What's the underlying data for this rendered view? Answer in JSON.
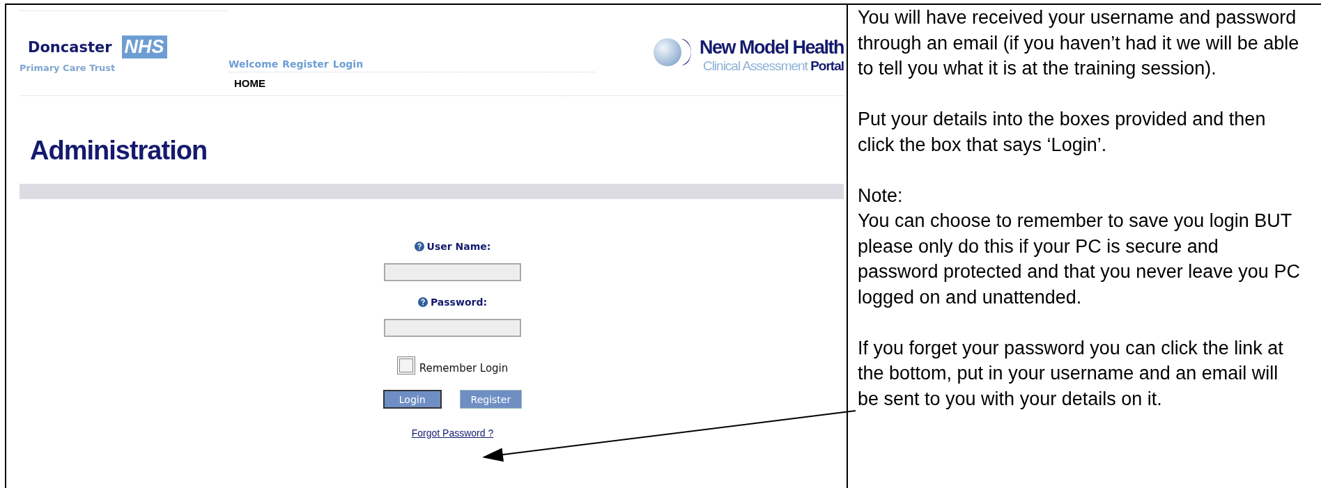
{
  "header": {
    "org_logo": {
      "name": "Doncaster",
      "badge": "NHS",
      "subtitle": "Primary Care Trust"
    },
    "top_links": [
      "Welcome",
      "Register",
      "Login"
    ],
    "nav": [
      "HOME"
    ],
    "brand": {
      "name": "New Model Health",
      "tagline_light": "Clinical Assessment",
      "tagline_bold": "Portal"
    }
  },
  "page_title": "Administration",
  "login_form": {
    "fields": [
      {
        "label": "User Name:"
      },
      {
        "label": "Password:"
      }
    ],
    "remember": {
      "label": "Remember Login",
      "checked": false
    },
    "buttons": [
      {
        "label": "Login",
        "focused": true
      },
      {
        "label": "Register",
        "focused": false
      }
    ],
    "forgot_link": "Forgot Password ?"
  },
  "notes": [
    {
      "lines": [
        "You will have received your username and password through an email (if you haven’t had it we will be able to tell you what it is at the training session)."
      ]
    },
    {
      "lines": [
        "Put your details into the boxes provided and then click the box that says ‘Login’."
      ]
    },
    {
      "lines": [
        "Note:",
        "You can choose to remember to save you login BUT please only do this if your PC is secure and password protected and that you never leave you PC logged on and unattended."
      ]
    },
    {
      "lines": [
        "If you forget your password you can click the link at the bottom, put in your username and an email will be sent to you with your details on it."
      ]
    }
  ]
}
